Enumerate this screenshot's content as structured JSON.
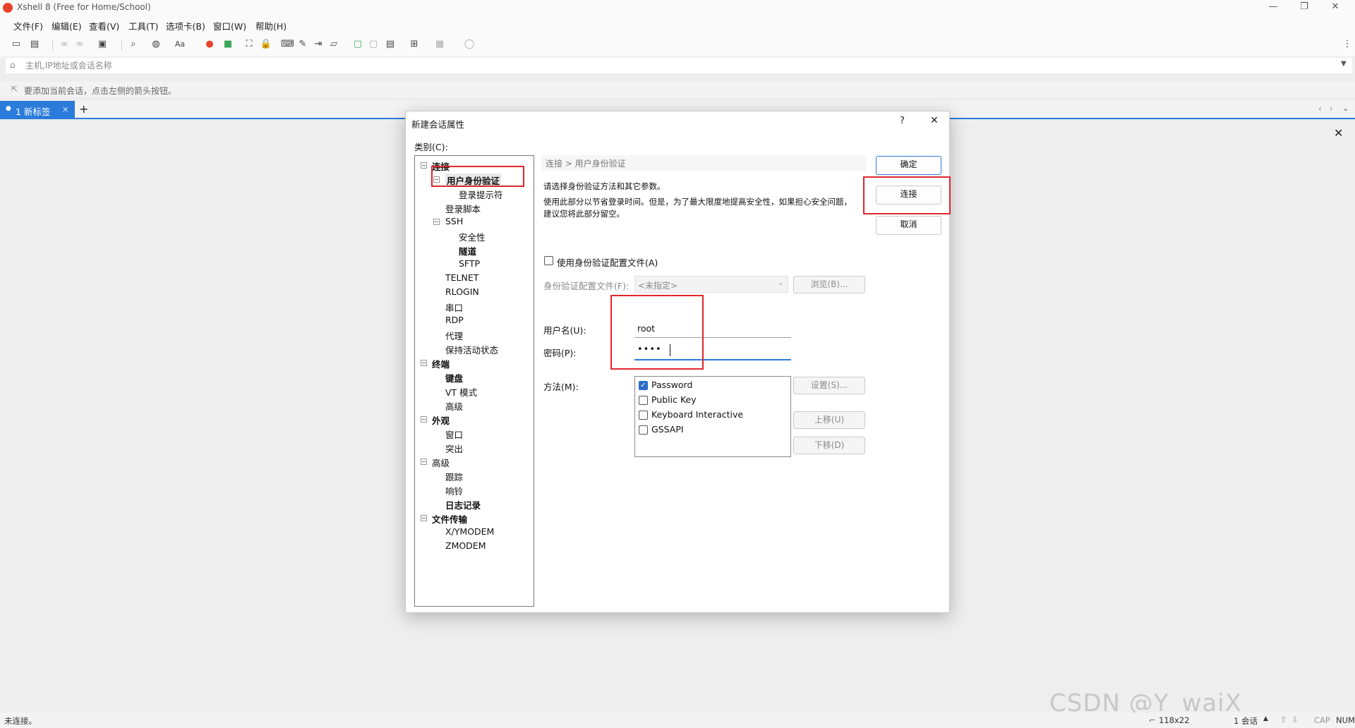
{
  "window": {
    "title": "Xshell 8 (Free for Home/School)",
    "minimize": "—",
    "maximize": "❐",
    "close": "✕"
  },
  "menu": [
    "文件(F)",
    "编辑(E)",
    "查看(V)",
    "工具(T)",
    "选项卡(B)",
    "窗口(W)",
    "帮助(H)"
  ],
  "address_bar": {
    "placeholder": "主机,IP地址或会话名称"
  },
  "hint": "要添加当前会话，点击左侧的箭头按钮。",
  "tabs": {
    "active_label": "1 新标签",
    "close": "✕",
    "add": "+"
  },
  "status": {
    "left": "未连接。",
    "size": "118x22",
    "sessions": "1 会话",
    "cap": "CAP",
    "num": "NUM"
  },
  "watermark": "CSDN @Y_waiX",
  "dialog": {
    "title": "新建会话属性",
    "help": "?",
    "close": "✕",
    "category_label": "类别(C):",
    "tree": [
      {
        "label": "连接",
        "bold": true,
        "level": 0,
        "toggle": "⊟"
      },
      {
        "label": "用户身份验证",
        "bold": true,
        "level": 1,
        "toggle": "⊟",
        "selected": true
      },
      {
        "label": "登录提示符",
        "bold": false,
        "level": 2
      },
      {
        "label": "登录脚本",
        "bold": false,
        "level": 1
      },
      {
        "label": "SSH",
        "bold": false,
        "level": 1,
        "toggle": "⊟"
      },
      {
        "label": "安全性",
        "bold": false,
        "level": 2
      },
      {
        "label": "隧道",
        "bold": true,
        "level": 2
      },
      {
        "label": "SFTP",
        "bold": false,
        "level": 2
      },
      {
        "label": "TELNET",
        "bold": false,
        "level": 1
      },
      {
        "label": "RLOGIN",
        "bold": false,
        "level": 1
      },
      {
        "label": "串口",
        "bold": false,
        "level": 1
      },
      {
        "label": "RDP",
        "bold": false,
        "level": 1
      },
      {
        "label": "代理",
        "bold": false,
        "level": 1
      },
      {
        "label": "保持活动状态",
        "bold": false,
        "level": 1
      },
      {
        "label": "终端",
        "bold": true,
        "level": 0,
        "toggle": "⊟"
      },
      {
        "label": "键盘",
        "bold": true,
        "level": 1
      },
      {
        "label": "VT 模式",
        "bold": false,
        "level": 1
      },
      {
        "label": "高级",
        "bold": false,
        "level": 1
      },
      {
        "label": "外观",
        "bold": true,
        "level": 0,
        "toggle": "⊟"
      },
      {
        "label": "窗口",
        "bold": false,
        "level": 1
      },
      {
        "label": "突出",
        "bold": false,
        "level": 1
      },
      {
        "label": "高级",
        "bold": false,
        "level": 0,
        "toggle": "⊟"
      },
      {
        "label": "跟踪",
        "bold": false,
        "level": 1
      },
      {
        "label": "响铃",
        "bold": false,
        "level": 1
      },
      {
        "label": "日志记录",
        "bold": true,
        "level": 1
      },
      {
        "label": "文件传输",
        "bold": true,
        "level": 0,
        "toggle": "⊟"
      },
      {
        "label": "X/YMODEM",
        "bold": false,
        "level": 1
      },
      {
        "label": "ZMODEM",
        "bold": false,
        "level": 1
      }
    ],
    "breadcrumb": "连接 > 用户身份验证",
    "desc1": "请选择身份验证方法和其它参数。",
    "desc2": "使用此部分以节省登录时间。但是，为了最大限度地提高安全性，如果担心安全问题，",
    "desc3": "建议您将此部分留空。",
    "use_profile_label": "使用身份验证配置文件(A)",
    "profile_label": "身份验证配置文件(F):",
    "profile_value": "<未指定>",
    "browse": "浏览(B)...",
    "username_label": "用户名(U):",
    "username_value": "root",
    "password_label": "密码(P):",
    "password_value": "••••",
    "method_label": "方法(M):",
    "methods": [
      {
        "label": "Password",
        "checked": true
      },
      {
        "label": "Public Key",
        "checked": false
      },
      {
        "label": "Keyboard Interactive",
        "checked": false
      },
      {
        "label": "GSSAPI",
        "checked": false
      }
    ],
    "settings": "设置(S)...",
    "move_up": "上移(U)",
    "move_down": "下移(D)",
    "ok": "确定",
    "connect": "连接",
    "cancel": "取消"
  },
  "colors": {
    "accent": "#2b7bdb",
    "annotation_red": "#e0262c",
    "logo": "#e8412c"
  }
}
